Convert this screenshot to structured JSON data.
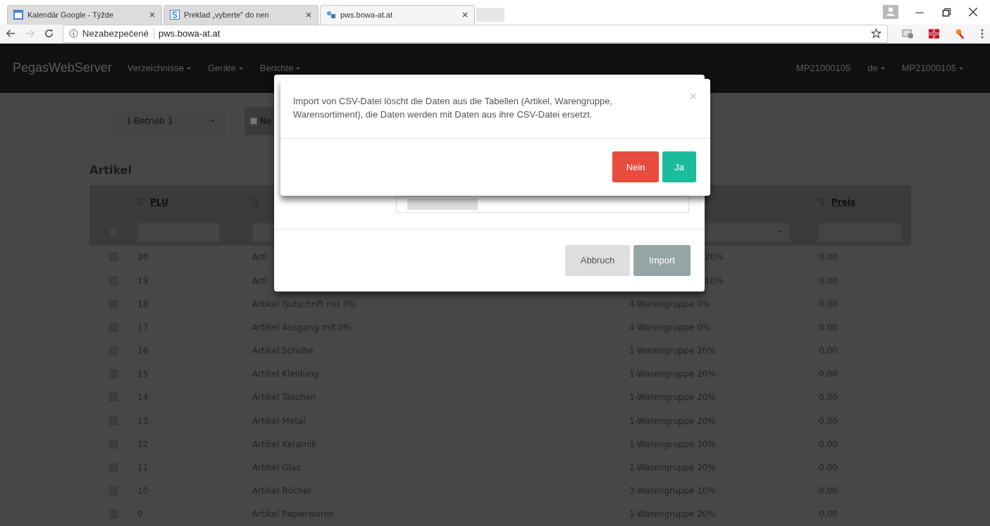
{
  "browser": {
    "tabs": [
      {
        "title": "Kalendár Google - Týžde",
        "kind": "calendar",
        "selected": false
      },
      {
        "title": "Preklad „vyberte\" do nen",
        "kind": "s",
        "selected": false
      },
      {
        "title": "pws.bowa-at.at",
        "kind": "site",
        "selected": true
      }
    ],
    "security_label": "Nezabezpečené",
    "url": "pws.bowa-at.at"
  },
  "navbar": {
    "brand": "PegasWebServer",
    "menus": [
      {
        "label": "Verzeichnisse",
        "dropdown": true
      },
      {
        "label": "Geräte",
        "dropdown": true
      },
      {
        "label": "Berichte",
        "dropdown": true
      }
    ],
    "right": [
      {
        "label": "MP21000105"
      },
      {
        "label": "de",
        "dropdown": true
      },
      {
        "label": "MP21000105",
        "dropdown": true
      }
    ]
  },
  "toolbar": {
    "store_select": "1-Betrieb 1",
    "new_button": "Ne"
  },
  "section_title": "Artikel",
  "table": {
    "select_all_checked": false,
    "columns": [
      {
        "label": "PLU",
        "sort_icon": true,
        "kind": "text"
      },
      {
        "sort_icon": true,
        "kind": "text"
      },
      {
        "kind": "select"
      },
      {
        "label": "Preis",
        "sort_icon": true,
        "kind": "text"
      }
    ],
    "rows": [
      {
        "checked": false,
        "plu": "20",
        "name": "Arti",
        "group": "20%",
        "price": "0.00",
        "covered": true
      },
      {
        "checked": false,
        "plu": "19",
        "name": "Arti",
        "group": "10%",
        "price": "0.00",
        "covered": true
      },
      {
        "checked": false,
        "plu": "18",
        "name": "Artikel Gutschrift mit 0%",
        "group": "4-Warengruppe 0%",
        "price": "0.00"
      },
      {
        "checked": false,
        "plu": "17",
        "name": "Artikel Ausgang mit 0%",
        "group": "4-Warengruppe 0%",
        "price": "0.00"
      },
      {
        "checked": false,
        "plu": "16",
        "name": "Artikel Schuhe",
        "group": "1-Warengruppe 20%",
        "price": "0.00"
      },
      {
        "checked": false,
        "plu": "15",
        "name": "Artikel Kleidung",
        "group": "1-Warengruppe 20%",
        "price": "0.00"
      },
      {
        "checked": false,
        "plu": "14",
        "name": "Artikel Taschen",
        "group": "1-Warengruppe 20%",
        "price": "0.00"
      },
      {
        "checked": false,
        "plu": "13",
        "name": "Artikel Metal",
        "group": "1-Warengruppe 20%",
        "price": "0.00"
      },
      {
        "checked": false,
        "plu": "12",
        "name": "Artikel Keramik",
        "group": "1-Warengruppe 20%",
        "price": "0.00"
      },
      {
        "checked": false,
        "plu": "11",
        "name": "Artikel Glas",
        "group": "1-Warengruppe 20%",
        "price": "0.00"
      },
      {
        "checked": false,
        "plu": "10",
        "name": "Artikel Bücher",
        "group": "3-Warengruppe 10%",
        "price": "0.00"
      },
      {
        "checked": false,
        "plu": "9",
        "name": "Artikel Papierwaren",
        "group": "1-Warengruppe 20%",
        "price": "0.00"
      }
    ]
  },
  "import_dialog": {
    "buttons": [
      {
        "label": "Abbruch",
        "kind": "cancel"
      },
      {
        "label": "Import",
        "kind": "primary"
      }
    ]
  },
  "confirm_dialog": {
    "message": "Import von CSV-Datei löscht die Daten aus die Tabellen (Artikel, Warengruppe, Warensortiment), die Daten werden mit Daten aus ihre CSV-Datei ersetzt.",
    "buttons": [
      {
        "label": "Nein",
        "kind": "danger"
      },
      {
        "label": "Ja",
        "kind": "success"
      }
    ]
  }
}
